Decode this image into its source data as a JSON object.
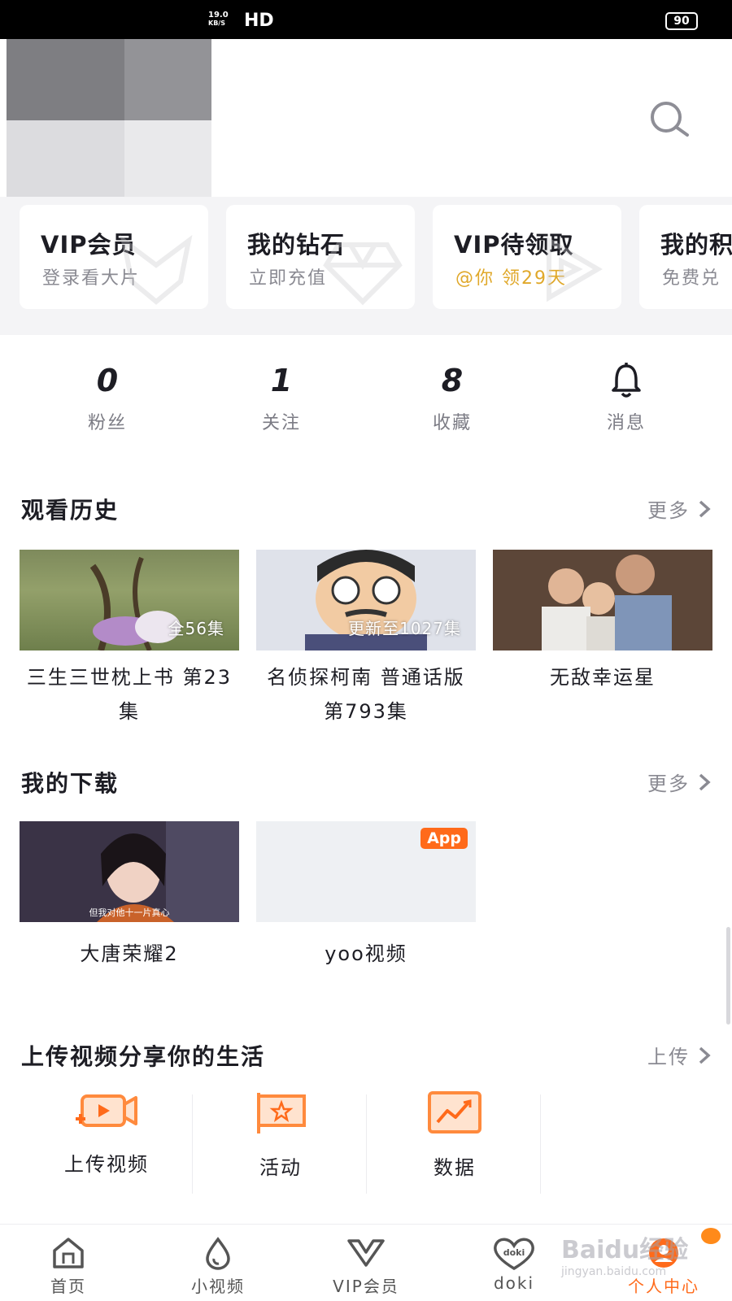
{
  "status_bar": {
    "speed": "19.0",
    "speed_unit": "KB/S",
    "hd": "HD",
    "battery": "90"
  },
  "vip_cards": [
    {
      "title": "VIP会员",
      "sub": "登录看大片"
    },
    {
      "title": "我的钻石",
      "sub": "立即充值"
    },
    {
      "title": "VIP待领取",
      "sub": "@你 领29天"
    },
    {
      "title": "我的积",
      "sub": "免费兑"
    }
  ],
  "stats": [
    {
      "num": "0",
      "label": "粉丝"
    },
    {
      "num": "1",
      "label": "关注"
    },
    {
      "num": "8",
      "label": "收藏"
    },
    {
      "label": "消息"
    }
  ],
  "history": {
    "title": "观看历史",
    "more": "更多",
    "items": [
      {
        "episode_badge": "全56集",
        "title": "三生三世枕上书 第23集"
      },
      {
        "episode_badge": "更新至1027集",
        "title": "名侦探柯南 普通话版 第793集"
      },
      {
        "episode_badge": "",
        "title": "无敌幸运星"
      }
    ]
  },
  "downloads": {
    "title": "我的下载",
    "more": "更多",
    "items": [
      {
        "title": "大唐荣耀2",
        "subtitle_overlay": "但我对他十一片真心"
      },
      {
        "title": "yoo视频",
        "badge": "App"
      }
    ]
  },
  "upload": {
    "title": "上传视频分享你的生活",
    "action": "上传",
    "tools": [
      {
        "label": "上传视频",
        "icon": "upload-video-icon"
      },
      {
        "label": "活动",
        "icon": "activity-flag-icon"
      },
      {
        "label": "数据",
        "icon": "data-chart-icon"
      }
    ]
  },
  "bottom_nav": [
    {
      "label": "首页",
      "icon": "home-icon"
    },
    {
      "label": "小视频",
      "icon": "drop-icon"
    },
    {
      "label": "VIP会员",
      "icon": "vip-icon"
    },
    {
      "label": "doki",
      "icon": "doki-heart-icon",
      "icon_text": "doki"
    },
    {
      "label": "个人中心",
      "icon": "profile-icon",
      "active": true
    }
  ],
  "watermark": {
    "brand": "Baidu经验",
    "url": "jingyan.baidu.com"
  },
  "colors": {
    "accent": "#ff6a1a",
    "gold": "#e0a82a",
    "text": "#1d1d24",
    "muted": "#8a8a92"
  }
}
